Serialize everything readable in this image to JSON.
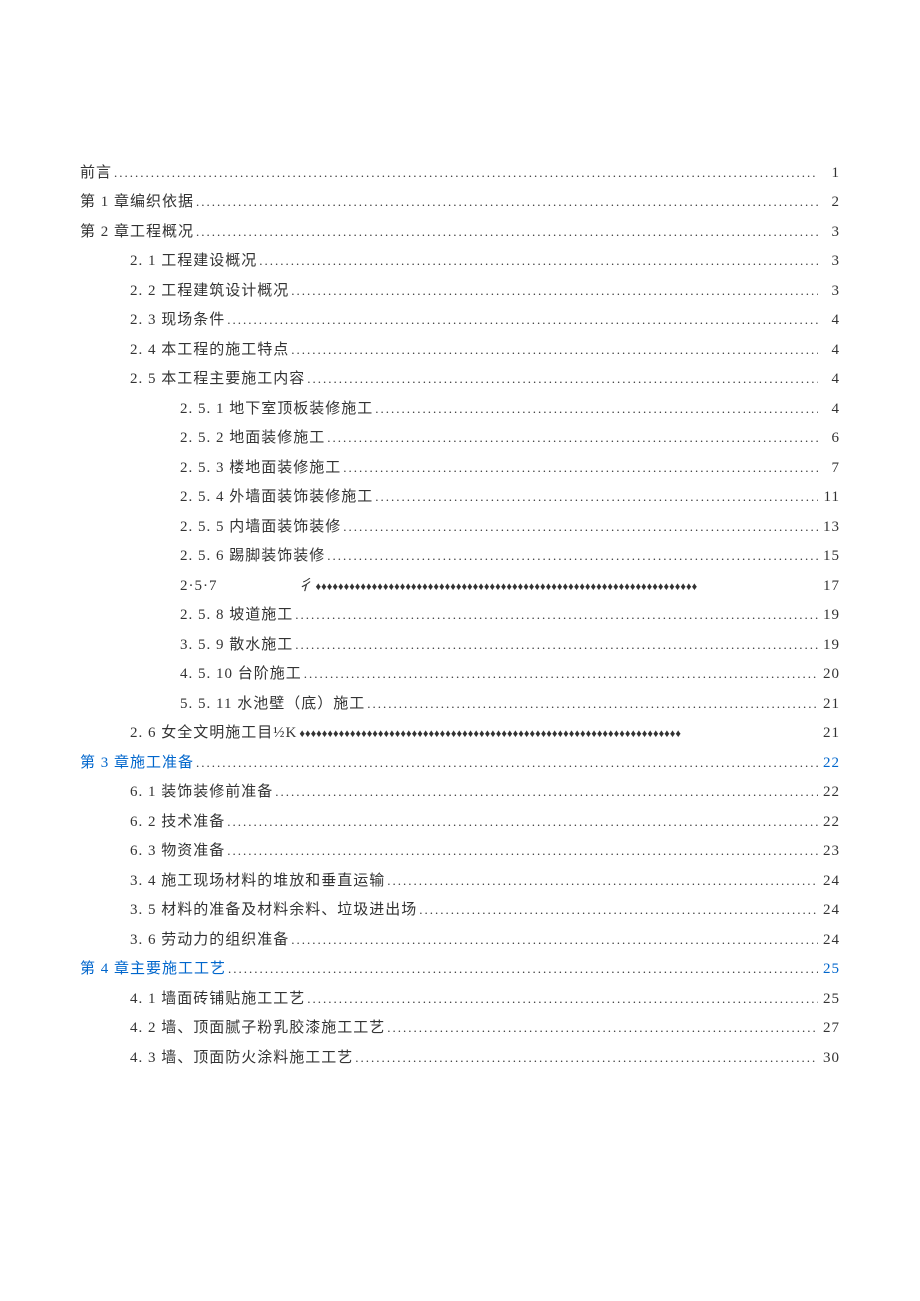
{
  "toc": [
    {
      "indent": 0,
      "label": "前言",
      "page": "1",
      "leader": "dots",
      "link": false
    },
    {
      "indent": 0,
      "label": "第 1 章编织依据",
      "page": "2",
      "leader": "dots",
      "link": false
    },
    {
      "indent": 0,
      "label": "第 2 章工程概况",
      "page": "3",
      "leader": "dots",
      "link": false
    },
    {
      "indent": 1,
      "label": "2. 1 工程建设概况",
      "page": "3",
      "leader": "dots",
      "link": false
    },
    {
      "indent": 1,
      "label": "2. 2 工程建筑设计概况",
      "page": "3",
      "leader": "dots",
      "link": false
    },
    {
      "indent": 1,
      "label": "2. 3 现场条件",
      "page": "4",
      "leader": "dots",
      "link": false
    },
    {
      "indent": 1,
      "label": "2. 4 本工程的施工特点",
      "page": "4",
      "leader": "dots",
      "link": false
    },
    {
      "indent": 1,
      "label": "2. 5 本工程主要施工内容",
      "page": "4",
      "leader": "dots",
      "link": false
    },
    {
      "indent": 2,
      "label": "2. 5. 1 地下室顶板装修施工",
      "page": "4",
      "leader": "dots",
      "link": false
    },
    {
      "indent": 2,
      "label": "2. 5. 2 地面装修施工",
      "page": "6",
      "leader": "dots",
      "link": false
    },
    {
      "indent": 2,
      "label": "2. 5. 3 楼地面装修施工",
      "page": "7",
      "leader": "dots",
      "link": false
    },
    {
      "indent": 2,
      "label": "2. 5. 4 外墙面装饰装修施工 ",
      "page": "11",
      "leader": "dots",
      "link": false
    },
    {
      "indent": 2,
      "label": "2. 5. 5 内墙面装饰装修 ",
      "page": "13",
      "leader": "dots",
      "link": false
    },
    {
      "indent": 2,
      "label": "2. 5. 6 踢脚装饰装修 ",
      "page": "15",
      "leader": "dots",
      "link": false
    },
    {
      "indent": 2,
      "label_a": "2·5·7",
      "label_b": "彳 ",
      "page": "17",
      "leader": "diamond",
      "link": false,
      "special": true
    },
    {
      "indent": 2,
      "label": "2.   5. 8 坡道施工 ",
      "page": "19",
      "leader": "dots",
      "link": false
    },
    {
      "indent": 2,
      "label": "3.   5. 9 散水施工 ",
      "page": "19",
      "leader": "dots",
      "link": false
    },
    {
      "indent": 2,
      "label": "4.   5. 10 台阶施工 ",
      "page": "20",
      "leader": "dots",
      "link": false
    },
    {
      "indent": 2,
      "label": "5.   5. 11 水池壁（底）施工 ",
      "page": "21",
      "leader": "dots",
      "link": false
    },
    {
      "indent": 1,
      "label": "2. 6 女全文明施工目½K",
      "page": "21",
      "leader": "diamond",
      "link": false
    },
    {
      "indent": 0,
      "label": "第 3 章施工准备 ",
      "page": "22",
      "leader": "dots",
      "link": true
    },
    {
      "indent": 1,
      "label": "6.   1 装饰装修前准备",
      "page": "22",
      "leader": "dots",
      "link": false
    },
    {
      "indent": 1,
      "label": "6. 2   技术准备",
      "page": "22",
      "leader": "dots",
      "link": false
    },
    {
      "indent": 1,
      "label": "6. 3   物资准备",
      "page": "23",
      "leader": "dots",
      "link": false
    },
    {
      "indent": 1,
      "label": "3.   4 施工现场材料的堆放和垂直运输",
      "page": "24",
      "leader": "dots",
      "link": false
    },
    {
      "indent": 1,
      "label": "3. 5   材料的准备及材料余料、垃圾进出场",
      "page": "24",
      "leader": "dots",
      "link": false
    },
    {
      "indent": 1,
      "label": "3. 6   劳动力的组织准备",
      "page": "24",
      "leader": "dots",
      "link": false
    },
    {
      "indent": 0,
      "label": "第 4 章主要施工工艺 ",
      "page": "25",
      "leader": "dots",
      "link": true
    },
    {
      "indent": 1,
      "label": "4.   1 墙面砖铺贴施工工艺",
      "page": "25",
      "leader": "dots",
      "link": false
    },
    {
      "indent": 1,
      "label": "4. 2 墙、顶面腻子粉乳胶漆施工工艺",
      "page": "27",
      "leader": "dots",
      "link": false
    },
    {
      "indent": 1,
      "label": "4.   3 墙、顶面防火涂料施工工艺",
      "page": "30",
      "leader": "dots",
      "link": false
    }
  ]
}
